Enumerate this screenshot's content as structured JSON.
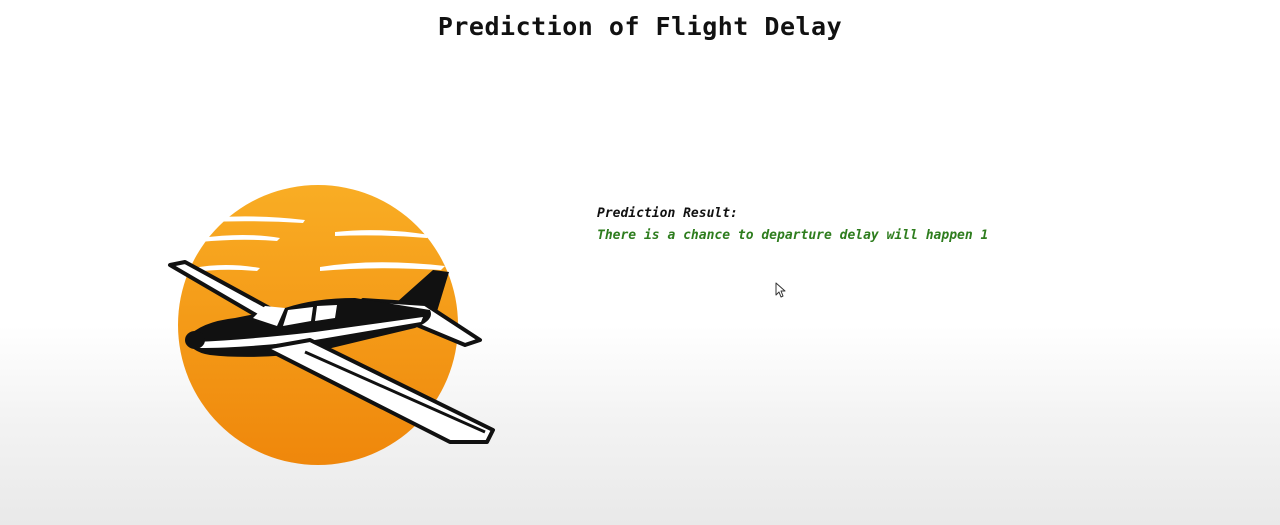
{
  "page": {
    "title": "Prediction of Flight Delay"
  },
  "logo": {
    "icon": "airplane-sunset-logo",
    "colors": {
      "sun": "#f7a21a",
      "sun_dark": "#ef8a0c",
      "plane": "#111111",
      "plane_highlight": "#ffffff"
    }
  },
  "result": {
    "heading": "Prediction Result:",
    "message": "There is a chance to departure delay will happen 1",
    "message_color": "#2e7d1e"
  },
  "pointer": {
    "icon": "mouse-cursor-icon"
  }
}
